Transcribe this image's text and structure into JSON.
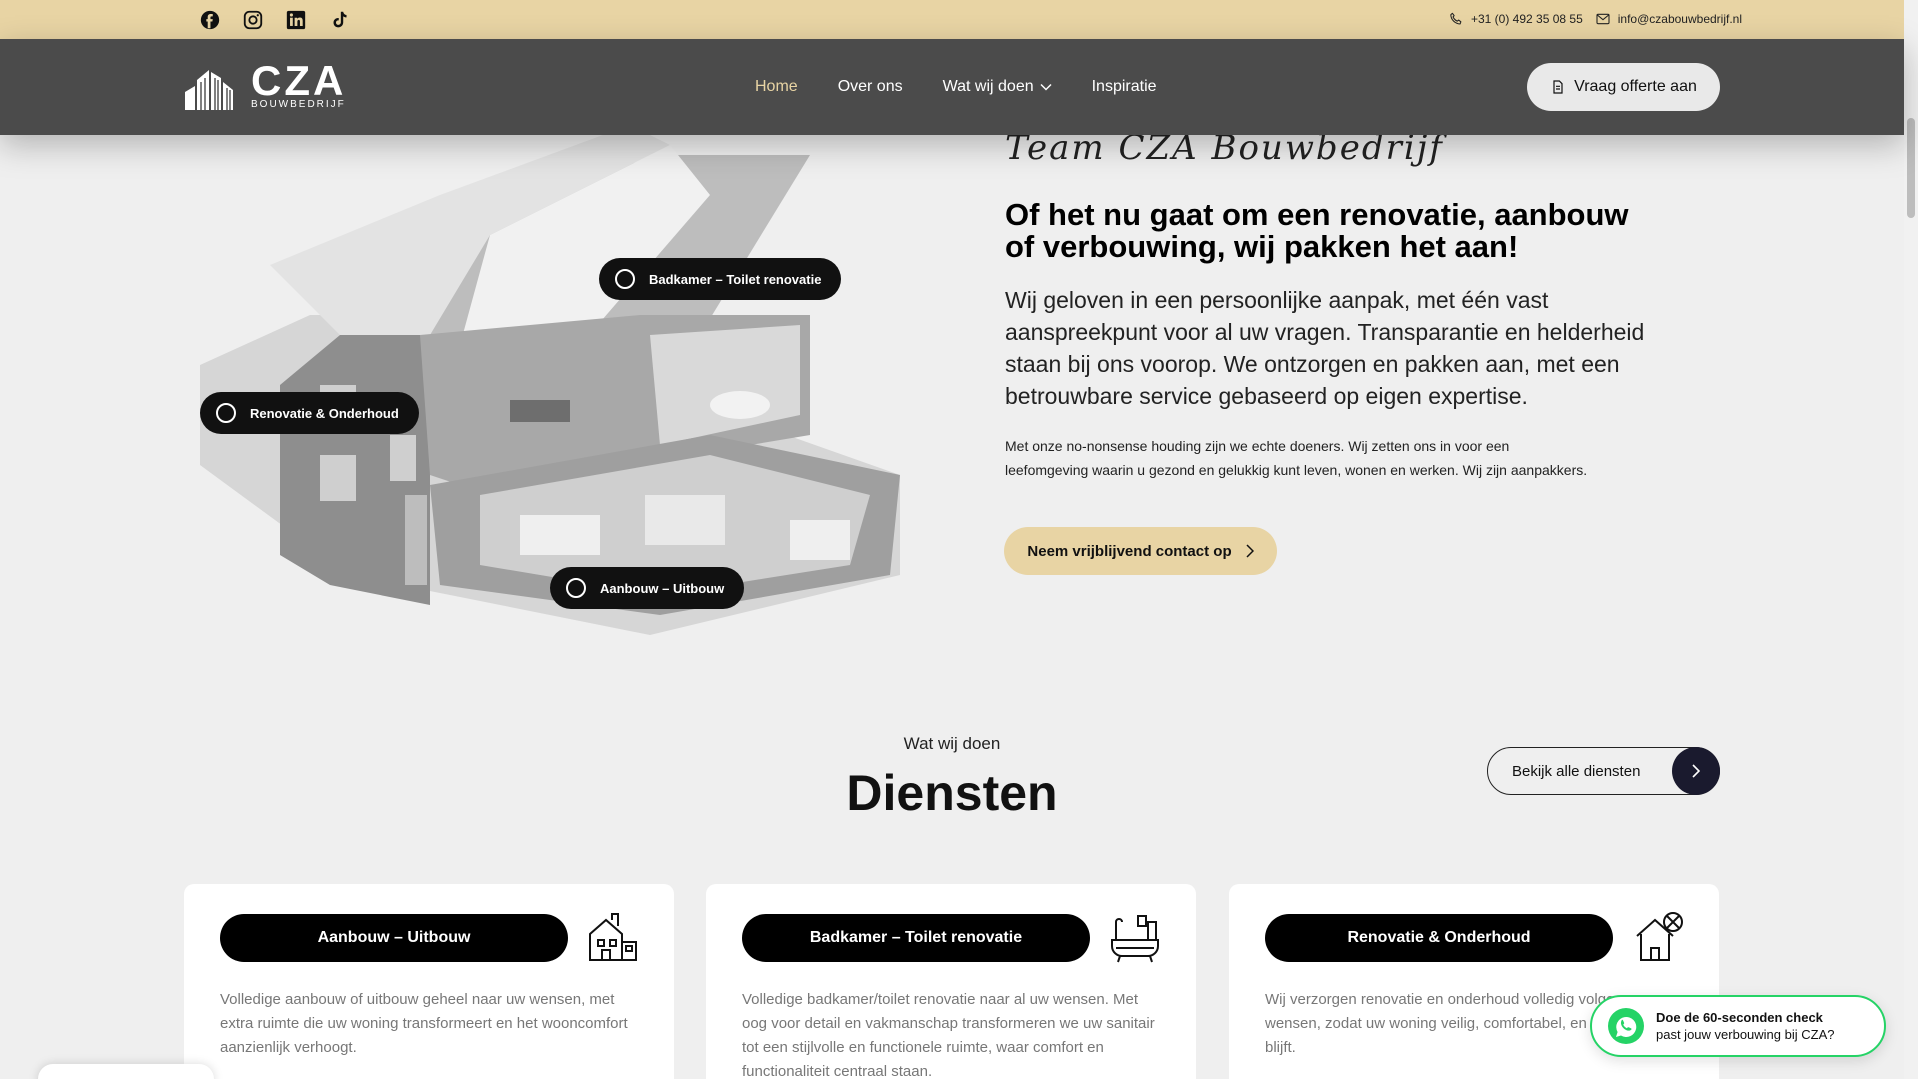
{
  "topbar": {
    "social": [
      "facebook-icon",
      "instagram-icon",
      "linkedin-icon",
      "tiktok-icon"
    ],
    "phone": "+31 (0) 492 35 08 55",
    "email": "info@czabouwbedrijf.nl"
  },
  "nav": {
    "logo": {
      "name": "CZA",
      "sub": "BOUWBEDRIJF"
    },
    "items": [
      {
        "label": "Home",
        "active": true
      },
      {
        "label": "Over ons"
      },
      {
        "label": "Wat wij doen",
        "dropdown": true
      },
      {
        "label": "Inspiratie"
      }
    ],
    "cta": "Vraag offerte aan"
  },
  "hero": {
    "pins": [
      "Badkamer – Toilet renovatie",
      "Renovatie & Onderhoud",
      "Aanbouw – Uitbouw"
    ],
    "script": "Team CZA Bouwbedrijf",
    "title": "Of het nu gaat om een renovatie, aanbouw of verbouwing, wij pakken het aan!",
    "lead": "Wij geloven in een persoonlijke aanpak, met één vast aanspreekpunt voor al uw vragen. Transparantie en helderheid staan bij ons voorop. We ontzorgen en pakken aan, met een betrouwbare service gebaseerd op eigen expertise.",
    "body": "Met onze no-nonsense houding zijn we echte doeners. Wij zetten ons in voor een leefomgeving waarin u gezond en gelukkig kunt leven, wonen en werken. Wij zijn aanpakkers.",
    "button": "Neem vrijblijvend contact op"
  },
  "services": {
    "eyebrow": "Wat wij doen",
    "title": "Diensten",
    "all_button": "Bekijk alle diensten",
    "cards": [
      {
        "title": "Aanbouw – Uitbouw",
        "icon": "house-extension-icon",
        "desc": "Volledige aanbouw of uitbouw geheel naar uw wensen, met extra ruimte die uw woning transformeert en het wooncomfort aanzienlijk verhoogt."
      },
      {
        "title": "Badkamer – Toilet renovatie",
        "icon": "bathtub-icon",
        "desc": "Volledige badkamer/toilet renovatie naar al uw wensen. Met oog voor detail en vakmanschap transformeren we uw sanitair tot een stijlvolle en functionele ruimte, waar comfort en functionaliteit centraal staan."
      },
      {
        "title": "Renovatie & Onderhoud",
        "icon": "house-tools-icon",
        "desc": "Wij verzorgen renovatie en onderhoud volledig volgens uw wensen, zodat uw woning veilig, comfortabel, en up-to-date blijft."
      }
    ]
  },
  "whatsapp": {
    "line1": "Doe de 60-seconden check",
    "line2": "past jouw verbouwing bij CZA?"
  }
}
